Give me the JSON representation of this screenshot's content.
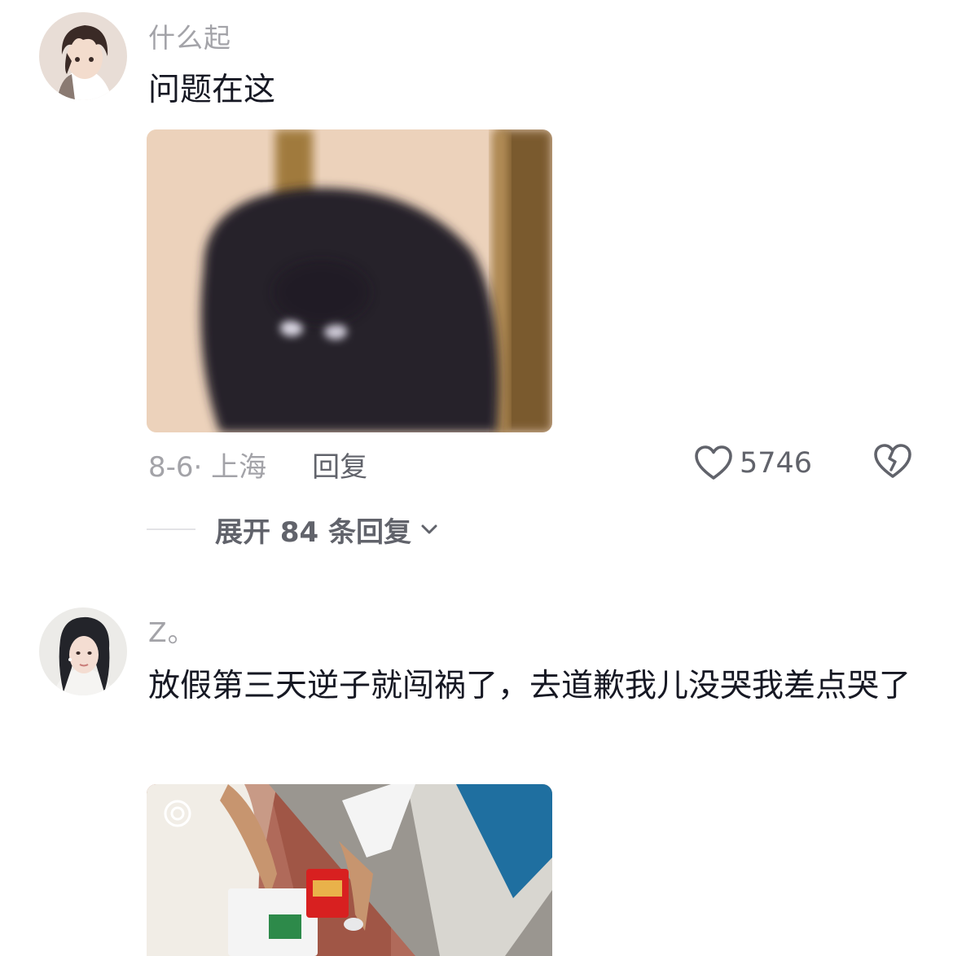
{
  "comments": [
    {
      "username": "什么起",
      "text": "问题在这",
      "date_location": "8-6· 上海",
      "reply_label": "回复",
      "like_count": "5746",
      "expand_label": "展开 84 条回复"
    },
    {
      "username": "Z。",
      "text": "放假第三天逆子就闯祸了，去道歉我儿没哭我差点哭了"
    }
  ],
  "icons": {
    "like": "heart-outline-icon",
    "dislike": "broken-heart-icon",
    "expand": "chevron-down-icon"
  },
  "colors": {
    "text_primary": "#161823",
    "text_secondary": "#a3a3a8",
    "text_action": "#61636b"
  }
}
